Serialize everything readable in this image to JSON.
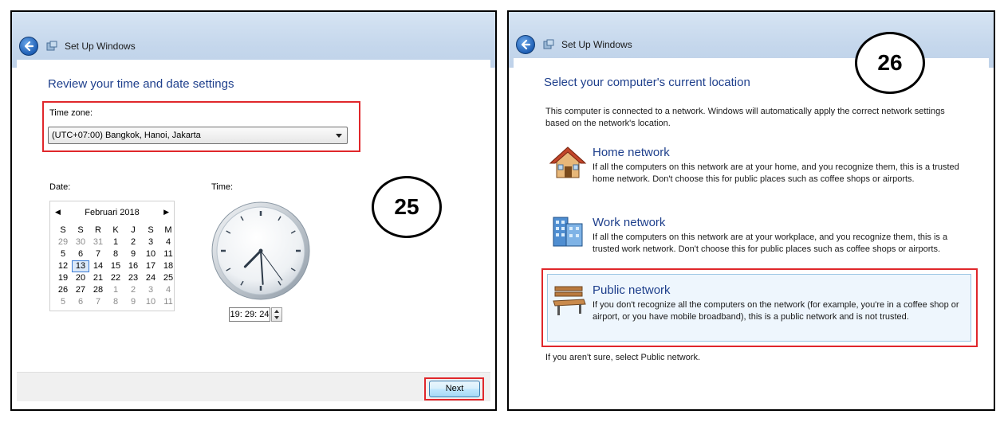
{
  "left": {
    "window_title": "Set Up Windows",
    "heading": "Review your time and date settings",
    "timezone": {
      "label": "Time zone:",
      "value": "(UTC+07:00) Bangkok, Hanoi, Jakarta"
    },
    "date_label": "Date:",
    "time_label": "Time:",
    "calendar": {
      "prev": "◀",
      "next": "▶",
      "month": "Februari 2018",
      "weekdays": [
        "S",
        "S",
        "R",
        "K",
        "J",
        "S",
        "M"
      ],
      "weeks": [
        [
          "29",
          "30",
          "31",
          "1",
          "2",
          "3",
          "4"
        ],
        [
          "5",
          "6",
          "7",
          "8",
          "9",
          "10",
          "11"
        ],
        [
          "12",
          "13",
          "14",
          "15",
          "16",
          "17",
          "18"
        ],
        [
          "19",
          "20",
          "21",
          "22",
          "23",
          "24",
          "25"
        ],
        [
          "26",
          "27",
          "28",
          "1",
          "2",
          "3",
          "4"
        ],
        [
          "5",
          "6",
          "7",
          "8",
          "9",
          "10",
          "11"
        ]
      ],
      "selected": "13"
    },
    "time_value": "19: 29: 24",
    "clock": {
      "hour": 19,
      "minute": 29,
      "second": 24
    },
    "next_button": "Next",
    "step_number": "25"
  },
  "right": {
    "window_title": "Set Up Windows",
    "heading": "Select your computer's current location",
    "intro": "This computer is connected to a network. Windows will automatically apply the correct network settings based on the network's location.",
    "options": [
      {
        "title": "Home network",
        "icon": "house-icon",
        "desc": "If all the computers on this network are at your home, and you recognize them, this is a trusted home network.  Don't choose this for public places such as coffee shops or airports."
      },
      {
        "title": "Work network",
        "icon": "office-building-icon",
        "desc": "If all the computers on this network are at your workplace, and you recognize them, this is a trusted work network.  Don't choose this for public places such as coffee shops or airports."
      },
      {
        "title": "Public network",
        "icon": "park-bench-icon",
        "desc": "If you don't recognize all the computers on the network (for example, you're in a coffee shop or airport, or you have mobile broadband), this is a public network and is not trusted."
      }
    ],
    "footer_note": "If you aren't sure, select Public network.",
    "step_number": "26"
  },
  "colors": {
    "highlight": "#e0272b",
    "heading_blue": "#1e3f8c"
  }
}
